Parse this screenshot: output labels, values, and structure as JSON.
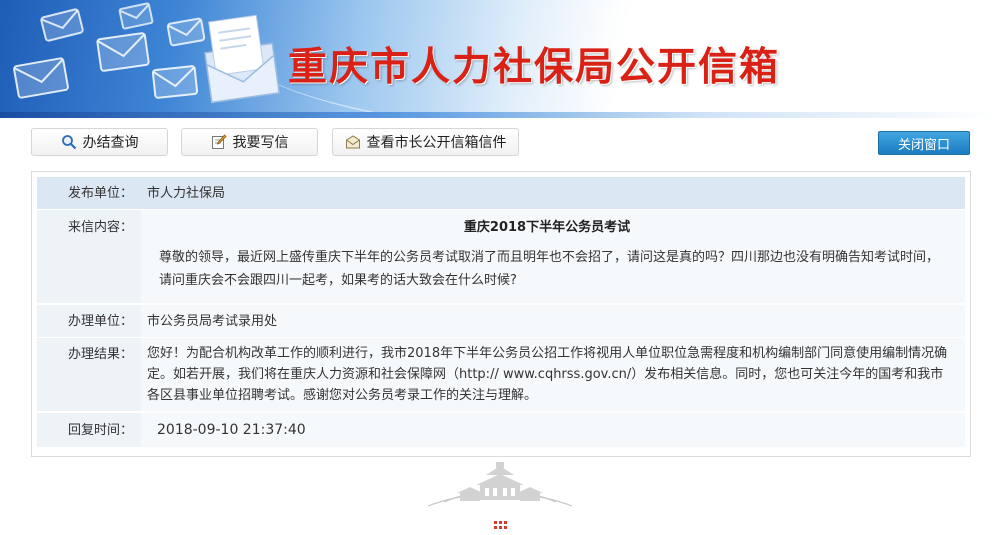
{
  "banner": {
    "title": "重庆市人力社保局公开信箱"
  },
  "toolbar": {
    "query_label": "办结查询",
    "write_label": "我要写信",
    "mayor_mailbox_label": "查看市长公开信箱信件",
    "close_label": "关闭窗口"
  },
  "detail": {
    "publisher": {
      "label": "发布单位：",
      "value": "市人力社保局"
    },
    "letter": {
      "label": "来信内容：",
      "subject": "重庆2018下半年公务员考试",
      "content": "尊敬的领导，最近网上盛传重庆下半年的公务员考试取消了而且明年也不会招了，请问这是真的吗？四川那边也没有明确告知考试时间，请问重庆会不会跟四川一起考，如果考的话大致会在什么时候?"
    },
    "handler": {
      "label": "办理单位：",
      "value": "市公务员局考试录用处"
    },
    "result": {
      "label": "办理结果：",
      "value": "您好！为配合机构改革工作的顺利进行，我市2018年下半年公务员公招工作将视用人单位职位急需程度和机构编制部门同意使用编制情况确定。如若开展，我们将在重庆人力资源和社会保障网（http:// www.cqhrss.gov.cn/）发布相关信息。同时，您也可关注今年的国考和我市各区县事业单位招聘考试。感谢您对公务员考录工作的关注与理解。"
    },
    "reply_time": {
      "label": "回复时间：",
      "value": "2018-09-10 21:37:40"
    }
  },
  "colors": {
    "title_red": "#d92116",
    "label_bg": "#eef3f8",
    "header_row_bg": "#dce7f4",
    "close_button_blue": "#1b7cc0"
  },
  "icons": [
    "envelope-icon",
    "search-icon",
    "pencil-icon",
    "mail-icon",
    "city-emblem-icon"
  ]
}
